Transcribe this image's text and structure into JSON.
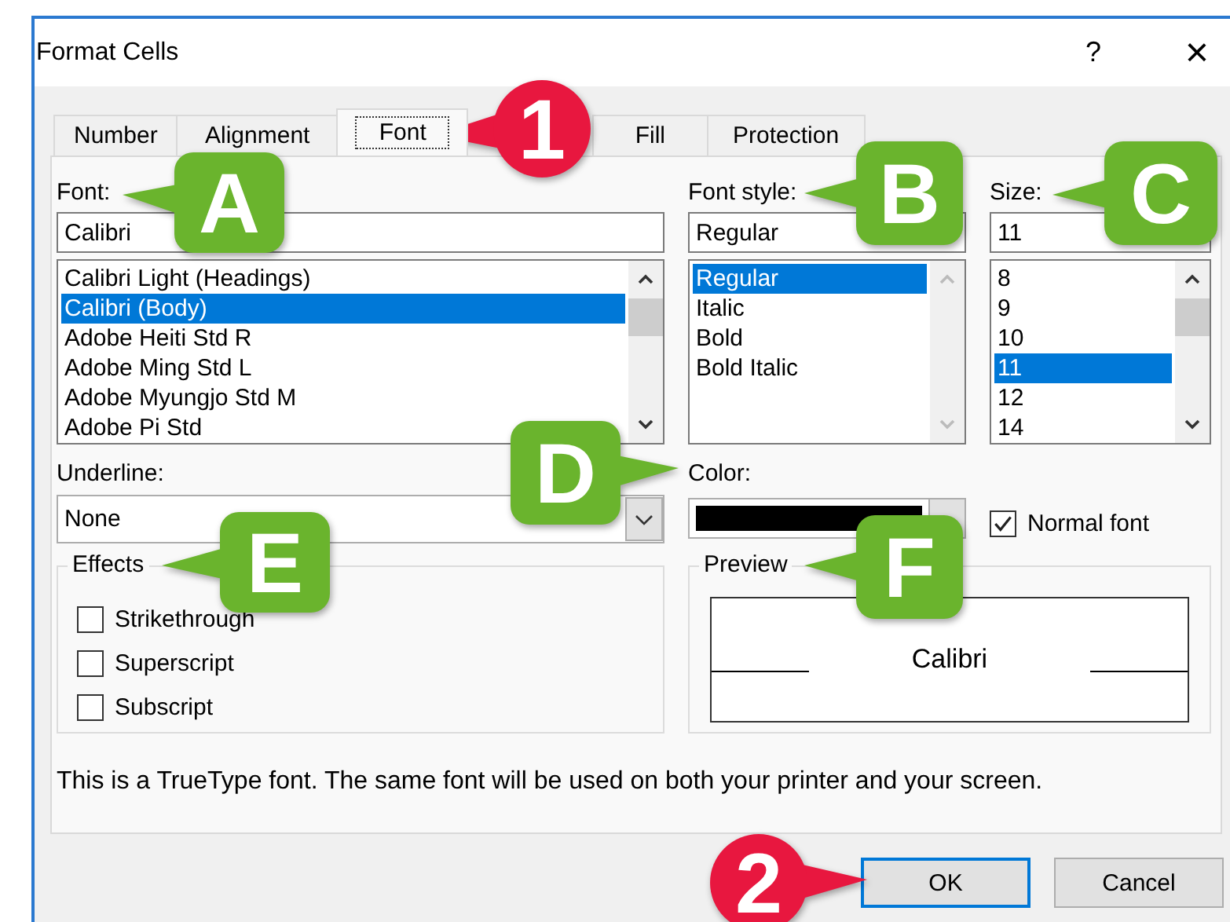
{
  "window": {
    "title": "Format Cells",
    "help": "?",
    "close": "×"
  },
  "tabs": [
    {
      "label": "Number",
      "selected": false
    },
    {
      "label": "Alignment",
      "selected": false
    },
    {
      "label": "Font",
      "selected": true
    },
    {
      "label": "Fill",
      "selected": false
    },
    {
      "label": "Protection",
      "selected": false
    }
  ],
  "font": {
    "label": "Font:",
    "value": "Calibri",
    "scrollable": true,
    "options": [
      {
        "label": "Calibri Light (Headings)",
        "selected": false
      },
      {
        "label": "Calibri (Body)",
        "selected": true
      },
      {
        "label": "Adobe Heiti Std R",
        "selected": false
      },
      {
        "label": "Adobe Ming Std L",
        "selected": false
      },
      {
        "label": "Adobe Myungjo Std M",
        "selected": false
      },
      {
        "label": "Adobe Pi Std",
        "selected": false
      }
    ]
  },
  "font_style": {
    "label": "Font style:",
    "value": "Regular",
    "scrollable": false,
    "options": [
      {
        "label": "Regular",
        "selected": true
      },
      {
        "label": "Italic",
        "selected": false
      },
      {
        "label": "Bold",
        "selected": false
      },
      {
        "label": "Bold Italic",
        "selected": false
      }
    ]
  },
  "size": {
    "label": "Size:",
    "value": "11",
    "scrollable": true,
    "options": [
      {
        "label": "8",
        "selected": false
      },
      {
        "label": "9",
        "selected": false
      },
      {
        "label": "10",
        "selected": false
      },
      {
        "label": "11",
        "selected": true
      },
      {
        "label": "12",
        "selected": false
      },
      {
        "label": "14",
        "selected": false
      }
    ]
  },
  "underline": {
    "label": "Underline:",
    "value": "None"
  },
  "color": {
    "label": "Color:",
    "color": "#000000"
  },
  "normal_font": {
    "label": "Normal font",
    "checked": true
  },
  "effects": {
    "title": "Effects",
    "options": [
      {
        "label": "Strikethrough",
        "checked": false
      },
      {
        "label": "Superscript",
        "checked": false
      },
      {
        "label": "Subscript",
        "checked": false
      }
    ]
  },
  "preview": {
    "title": "Preview",
    "sample": "Calibri"
  },
  "info": "This is a TrueType font.  The same font will be used on both your printer and your screen.",
  "buttons": [
    {
      "label": "OK",
      "default": true
    },
    {
      "label": "Cancel",
      "default": false
    }
  ],
  "callouts": [
    {
      "label": "1",
      "kind": "circle",
      "color": "#e8173f"
    },
    {
      "label": "A",
      "kind": "square",
      "color": "#6ab42d"
    },
    {
      "label": "B",
      "kind": "square",
      "color": "#6ab42d"
    },
    {
      "label": "C",
      "kind": "square",
      "color": "#6ab42d"
    },
    {
      "label": "D",
      "kind": "square",
      "color": "#6ab42d"
    },
    {
      "label": "E",
      "kind": "square",
      "color": "#6ab42d"
    },
    {
      "label": "F",
      "kind": "square",
      "color": "#6ab42d"
    },
    {
      "label": "2",
      "kind": "circle",
      "color": "#e8173f"
    }
  ]
}
